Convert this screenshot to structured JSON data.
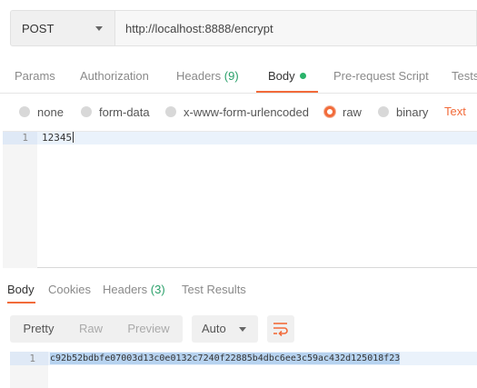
{
  "request": {
    "method": "POST",
    "url": "http://localhost:8888/encrypt"
  },
  "request_tabs": [
    {
      "label": "Params"
    },
    {
      "label": "Authorization"
    },
    {
      "label": "Headers",
      "count": "(9)"
    },
    {
      "label": "Body",
      "active": true
    },
    {
      "label": "Pre-request Script"
    },
    {
      "label": "Tests"
    }
  ],
  "body_types": [
    {
      "label": "none"
    },
    {
      "label": "form-data"
    },
    {
      "label": "x-www-form-urlencoded"
    },
    {
      "label": "raw",
      "selected": true
    },
    {
      "label": "binary"
    }
  ],
  "body_format": "Text",
  "request_editor": {
    "line_number": "1",
    "content": "12345"
  },
  "response_tabs": [
    {
      "label": "Body",
      "active": true
    },
    {
      "label": "Cookies"
    },
    {
      "label": "Headers",
      "count": "(3)"
    },
    {
      "label": "Test Results"
    }
  ],
  "response_toolbar": {
    "view_modes": [
      "Pretty",
      "Raw",
      "Preview"
    ],
    "format": "Auto"
  },
  "response_editor": {
    "line_number": "1",
    "content": "c92b52bdbfe07003d13c0e0132c7240f22885b4dbc6ee3c59ac432d125018f23"
  },
  "colors": {
    "accent": "#f26b3a",
    "count_green": "#2aa06a",
    "body_dot": "#2ab36a",
    "selection": "#b7d3f0"
  }
}
